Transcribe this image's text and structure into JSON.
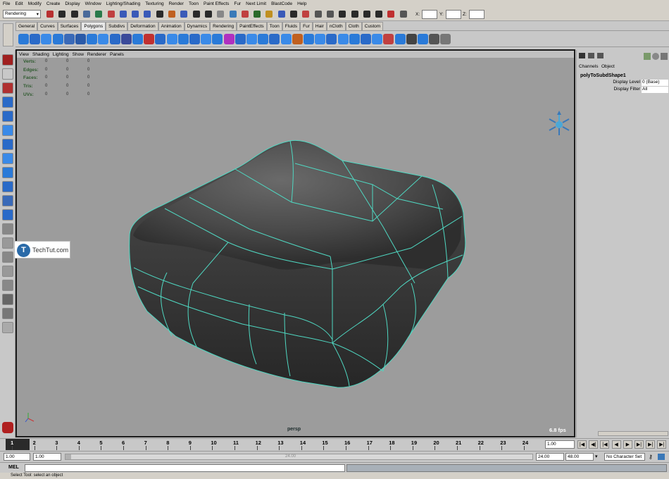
{
  "menu": [
    "File",
    "Edit",
    "Modify",
    "Create",
    "Display",
    "Window",
    "Lighting/Shading",
    "Texturing",
    "Render",
    "Toon",
    "Paint Effects",
    "Fur",
    "Next Limit",
    "BlastCode",
    "Help"
  ],
  "status": {
    "menu_set": "Rendering",
    "x_label": "X:",
    "y_label": "Y:",
    "z_label": "Z:"
  },
  "shelf_tabs": [
    "General",
    "Curves",
    "Surfaces",
    "Polygons",
    "Subdivs",
    "Deformation",
    "Animation",
    "Dynamics",
    "Rendering",
    "PaintEffects",
    "Toon",
    "Fluids",
    "Fur",
    "Hair",
    "nCloth",
    "Cloth",
    "Custom"
  ],
  "active_shelf_tab": "Polygons",
  "viewport": {
    "menu": [
      "View",
      "Shading",
      "Lighting",
      "Show",
      "Renderer",
      "Panels"
    ],
    "hud_labels": [
      "Verts:",
      "Edges:",
      "Faces:",
      "Tris:",
      "UVs:"
    ],
    "hud_values": [
      "0",
      "0",
      "0"
    ],
    "camera": "persp",
    "fps": "6.8 fps"
  },
  "channel_box": {
    "tabs": [
      "Channels",
      "Object"
    ],
    "node": "polyToSubdShape1",
    "rows": [
      {
        "label": "Display Level",
        "value": "0 (Base)"
      },
      {
        "label": "Display Filter",
        "value": "All"
      }
    ]
  },
  "time_slider": {
    "ticks": [
      "1",
      "2",
      "3",
      "4",
      "5",
      "6",
      "7",
      "8",
      "9",
      "10",
      "11",
      "12",
      "13",
      "14",
      "15",
      "16",
      "17",
      "18",
      "19",
      "20",
      "21",
      "22",
      "23",
      "24"
    ],
    "current_frame": "1.00"
  },
  "range": {
    "start": "1.00",
    "inner_start": "1.00",
    "handle": "24.00",
    "inner_end": "24.00",
    "end": "48.00",
    "char_set": "No Character Set"
  },
  "command": {
    "label": "MEL"
  },
  "help_line": "Select Tool: select an object",
  "watermark": {
    "logo": "T",
    "text": "TechTut.com"
  },
  "colors": {
    "viewport_bg": "#9c9c9c",
    "wire": "#4fd8c2",
    "ui_bg": "#c8c8c8"
  },
  "icons": [
    "select-tool-icon",
    "lasso-tool-icon",
    "paint-select-icon",
    "move-tool-icon",
    "rotate-tool-icon",
    "scale-tool-icon",
    "show-manipulator-icon",
    "last-tool-icon",
    "layout-single-icon",
    "layout-four-icon",
    "outliner-icon",
    "graph-editor-icon",
    "play-icon",
    "stop-icon",
    "step-forward-icon",
    "step-back-icon",
    "key-icon",
    "view-axis-icon"
  ]
}
